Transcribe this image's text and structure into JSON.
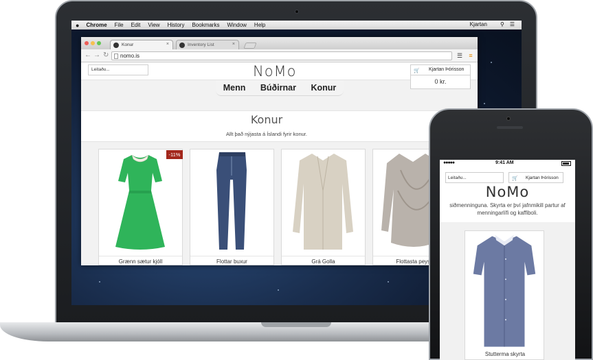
{
  "os_menubar": {
    "apple": "",
    "app": "Chrome",
    "items": [
      "File",
      "Edit",
      "View",
      "History",
      "Bookmarks",
      "Window",
      "Help"
    ],
    "user": "Kjartan"
  },
  "browser": {
    "tabs": [
      {
        "label": "Konur",
        "active": true
      },
      {
        "label": "Inventory List",
        "active": false
      }
    ],
    "url": "nomo.is"
  },
  "site": {
    "search_placeholder": "Leitaðu...",
    "logo": "NoMo",
    "user_name": "Kjartan Þórisson",
    "cart_total": "0 kr.",
    "nav": [
      "Menn",
      "Búðirnar",
      "Konur"
    ],
    "hero_title": "Konur",
    "hero_subtitle": "Allt það nýjasta á Íslandi fyrir konur.",
    "products": [
      {
        "name": "Grænn sætur kjóll",
        "discount": "-11%"
      },
      {
        "name": "Flottar buxur"
      },
      {
        "name": "Grá Golla"
      },
      {
        "name": "Flottasta peysa"
      }
    ]
  },
  "phone": {
    "time": "9:41 AM",
    "search_placeholder": "Leitaðu...",
    "user_name": "Kjartan Þórisson",
    "logo": "NoMo",
    "text": "siðmenninguna. Skyrta er því jafnmikill partur af menningarlífi og kaffiboli.",
    "product_name": "Stutterma skyrta"
  },
  "colors": {
    "discount_bg": "#a3271c",
    "dress_green": "#2fb45a",
    "jeans_blue": "#3a4f78"
  }
}
